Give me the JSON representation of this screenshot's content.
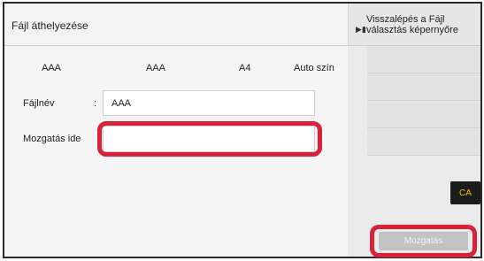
{
  "header": {
    "title": "Fájl áthelyezése"
  },
  "info_row": [
    "AAA",
    "AAA",
    "A4",
    "Auto szín"
  ],
  "form": {
    "filename_label": "Fájlnév",
    "colon": ":",
    "filename_value": "AAA",
    "destination_label": "Mozgatás ide",
    "destination_value": ""
  },
  "side": {
    "back_label": "Visszalépés a Fájl választás képernyőre",
    "ca_label": "CA",
    "move_label": "Mozgatás"
  },
  "colors": {
    "highlight": "#d8213b",
    "ca_text": "#e8c400",
    "ca_bg": "#1b1b1b"
  }
}
